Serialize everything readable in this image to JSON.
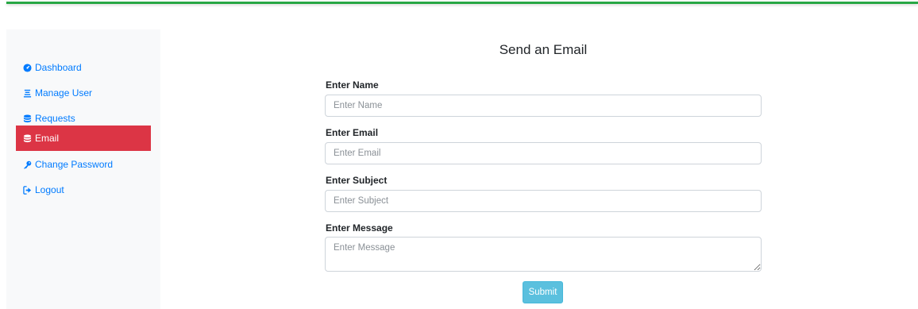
{
  "sidebar": {
    "items": [
      {
        "label": "Dashboard",
        "icon": "dashboard-icon"
      },
      {
        "label": "Manage User",
        "icon": "manage-user-icon"
      },
      {
        "label": "Requests",
        "icon": "database-icon"
      },
      {
        "label": "Email",
        "icon": "database-icon",
        "active": true
      },
      {
        "label": "Change Password",
        "icon": "key-icon"
      },
      {
        "label": "Logout",
        "icon": "logout-icon"
      }
    ]
  },
  "form": {
    "title": "Send an Email",
    "name_label": "Enter Name",
    "name_placeholder": "Enter Name",
    "email_label": "Enter Email",
    "email_placeholder": "Enter Email",
    "subject_label": "Enter Subject",
    "subject_placeholder": "Enter Subject",
    "message_label": "Enter Message",
    "message_placeholder": "Enter Message",
    "submit_label": "Submit"
  },
  "colors": {
    "accent_green": "#28a745",
    "active_red": "#dc3545",
    "link_blue": "#007bff",
    "submit_cyan": "#5bc0de"
  }
}
